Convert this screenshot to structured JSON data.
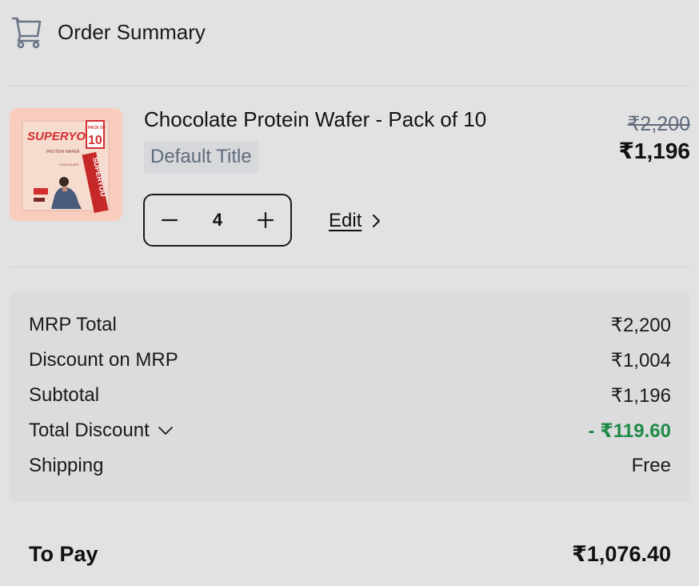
{
  "header": {
    "title": "Order Summary",
    "icon": "cart-icon"
  },
  "product": {
    "name": "Chocolate Protein Wafer - Pack of 10",
    "variant": "Default Title",
    "price_original": "₹2,200",
    "price_final": "₹1,196",
    "quantity": "4",
    "edit_label": "Edit",
    "image": {
      "brand": "SUPERYOU",
      "line": "PROTEIN WAFER",
      "flavor": "CHOCOLATE",
      "pack_label": "PACK OF",
      "pack_count": "10",
      "bg_color": "#f8cdbd",
      "accent_color": "#d32f2f"
    }
  },
  "summary": {
    "rows": [
      {
        "label": "MRP Total",
        "value": "₹2,200"
      },
      {
        "label": "Discount on MRP",
        "value": "₹1,004"
      },
      {
        "label": "Subtotal",
        "value": "₹1,196"
      },
      {
        "label": "Total Discount",
        "value": "- ₹119.60",
        "highlight": "#1f8a45"
      },
      {
        "label": "Shipping",
        "value": "Free"
      }
    ]
  },
  "to_pay": {
    "label": "To Pay",
    "value": "₹1,076.40"
  }
}
